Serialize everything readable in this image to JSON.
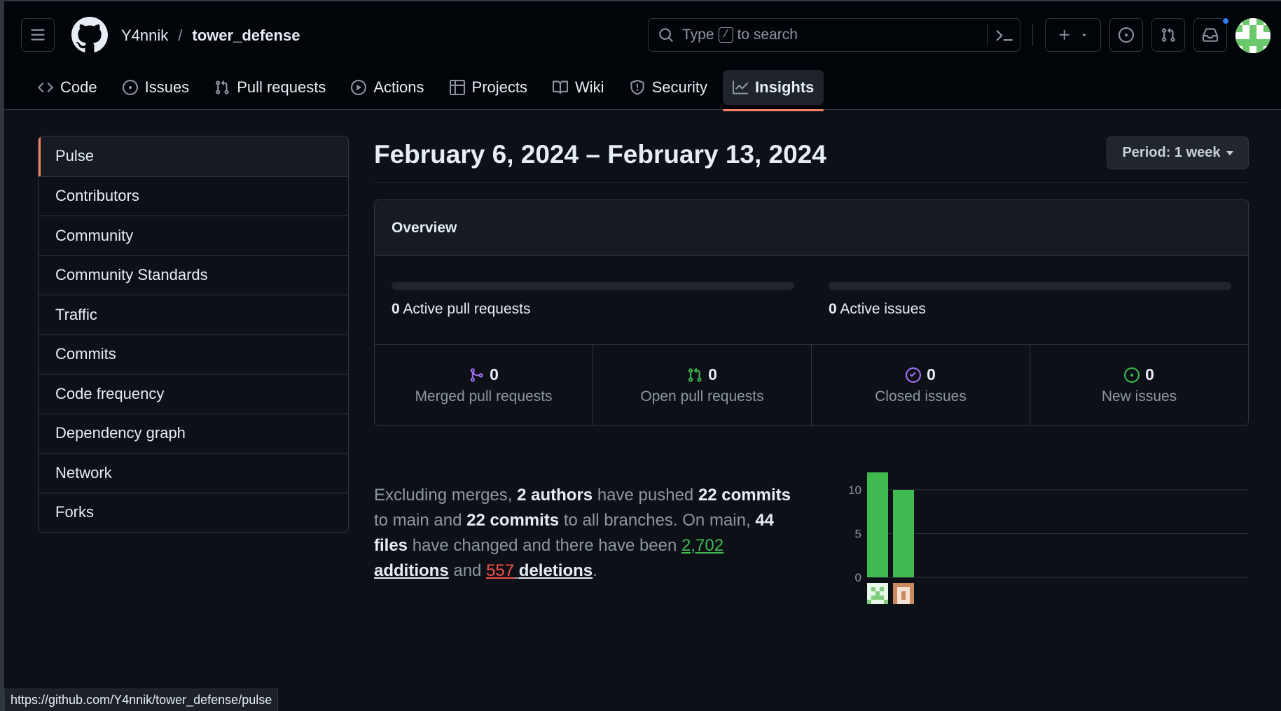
{
  "header": {
    "owner": "Y4nnik",
    "separator": "/",
    "repo": "tower_defense",
    "search": {
      "prefix": "Type",
      "key": "/",
      "suffix": "to search"
    },
    "icons": [
      "hamburger-icon",
      "github-logo-icon",
      "search-icon",
      "terminal-icon",
      "plus-icon",
      "issue-icon",
      "pull-request-icon",
      "inbox-icon"
    ]
  },
  "tabs": [
    {
      "label": "Code",
      "icon": "code-icon"
    },
    {
      "label": "Issues",
      "icon": "issue-icon"
    },
    {
      "label": "Pull requests",
      "icon": "pull-request-icon"
    },
    {
      "label": "Actions",
      "icon": "play-icon"
    },
    {
      "label": "Projects",
      "icon": "table-icon"
    },
    {
      "label": "Wiki",
      "icon": "book-icon"
    },
    {
      "label": "Security",
      "icon": "shield-icon"
    },
    {
      "label": "Insights",
      "icon": "graph-icon",
      "active": true
    }
  ],
  "sidebar": {
    "items": [
      {
        "label": "Pulse",
        "selected": true
      },
      {
        "label": "Contributors"
      },
      {
        "label": "Community"
      },
      {
        "label": "Community Standards"
      },
      {
        "label": "Traffic"
      },
      {
        "label": "Commits"
      },
      {
        "label": "Code frequency"
      },
      {
        "label": "Dependency graph"
      },
      {
        "label": "Network"
      },
      {
        "label": "Forks"
      }
    ]
  },
  "main": {
    "date_range": "February 6, 2024 – February 13, 2024",
    "period_label": "Period: 1 week",
    "overview": {
      "title": "Overview",
      "active_prs_count": "0",
      "active_prs_label": "Active pull requests",
      "active_issues_count": "0",
      "active_issues_label": "Active issues",
      "stats": [
        {
          "count": "0",
          "label": "Merged pull requests",
          "color": "#a371f7"
        },
        {
          "count": "0",
          "label": "Open pull requests",
          "color": "#3fb950"
        },
        {
          "count": "0",
          "label": "Closed issues",
          "color": "#a371f7"
        },
        {
          "count": "0",
          "label": "New issues",
          "color": "#3fb950"
        }
      ]
    },
    "summary": {
      "t1": "Excluding merges,",
      "authors": "2 authors",
      "t2": "have pushed",
      "commits_main": "22 commits",
      "t3": "to main and",
      "commits_all": "22 commits",
      "t4": "to all branches. On main,",
      "files": "44 files",
      "t5": "have changed and there have been",
      "additions_num": "2,702",
      "additions_word": "additions",
      "t6": "and",
      "deletions_num": "557",
      "deletions_word": "deletions",
      "t7": "."
    }
  },
  "chart_data": {
    "type": "bar",
    "categories": [
      "author-1",
      "author-2"
    ],
    "values": [
      12,
      10
    ],
    "ylim": [
      0,
      12
    ],
    "yticks": [
      0,
      5,
      10
    ],
    "color": "#3fb950",
    "grid": true
  },
  "status_bar": {
    "url": "https://github.com/Y4nnik/tower_defense/pulse"
  },
  "colors": {
    "accent": "#f78166",
    "link_blue": "#2f81f7",
    "green": "#3fb950",
    "red": "#f85149",
    "purple": "#a371f7"
  }
}
